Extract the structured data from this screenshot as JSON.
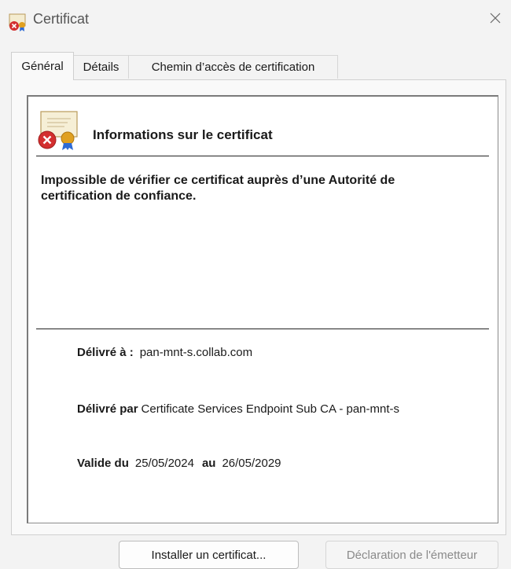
{
  "window": {
    "title": "Certificat"
  },
  "tabs": [
    {
      "label": "Général",
      "active": true
    },
    {
      "label": "Détails",
      "active": false
    },
    {
      "label": "Chemin d’accès de certification",
      "active": false
    }
  ],
  "info": {
    "heading": "Informations sur le certificat",
    "warning": "Impossible de vérifier ce certificat auprès d’une Autorité de certification de confiance."
  },
  "fields": {
    "issued_to_label": "Délivré à :",
    "issued_to_value": "pan-mnt-s.collab.com",
    "issued_by_label": "Délivré par",
    "issued_by_value": "Certificate Services Endpoint Sub CA - pan-mnt-s",
    "valid_from_label": "Valide du",
    "valid_from_value": "25/05/2024",
    "valid_to_label": "au",
    "valid_to_value": "26/05/2029"
  },
  "buttons": {
    "install": "Installer un certificat...",
    "issuer_statement": "Déclaration de l'émetteur"
  },
  "colors": {
    "error_red": "#d32f2f",
    "seal_gold": "#e0a020",
    "ribbon_blue": "#2e6bd6"
  }
}
